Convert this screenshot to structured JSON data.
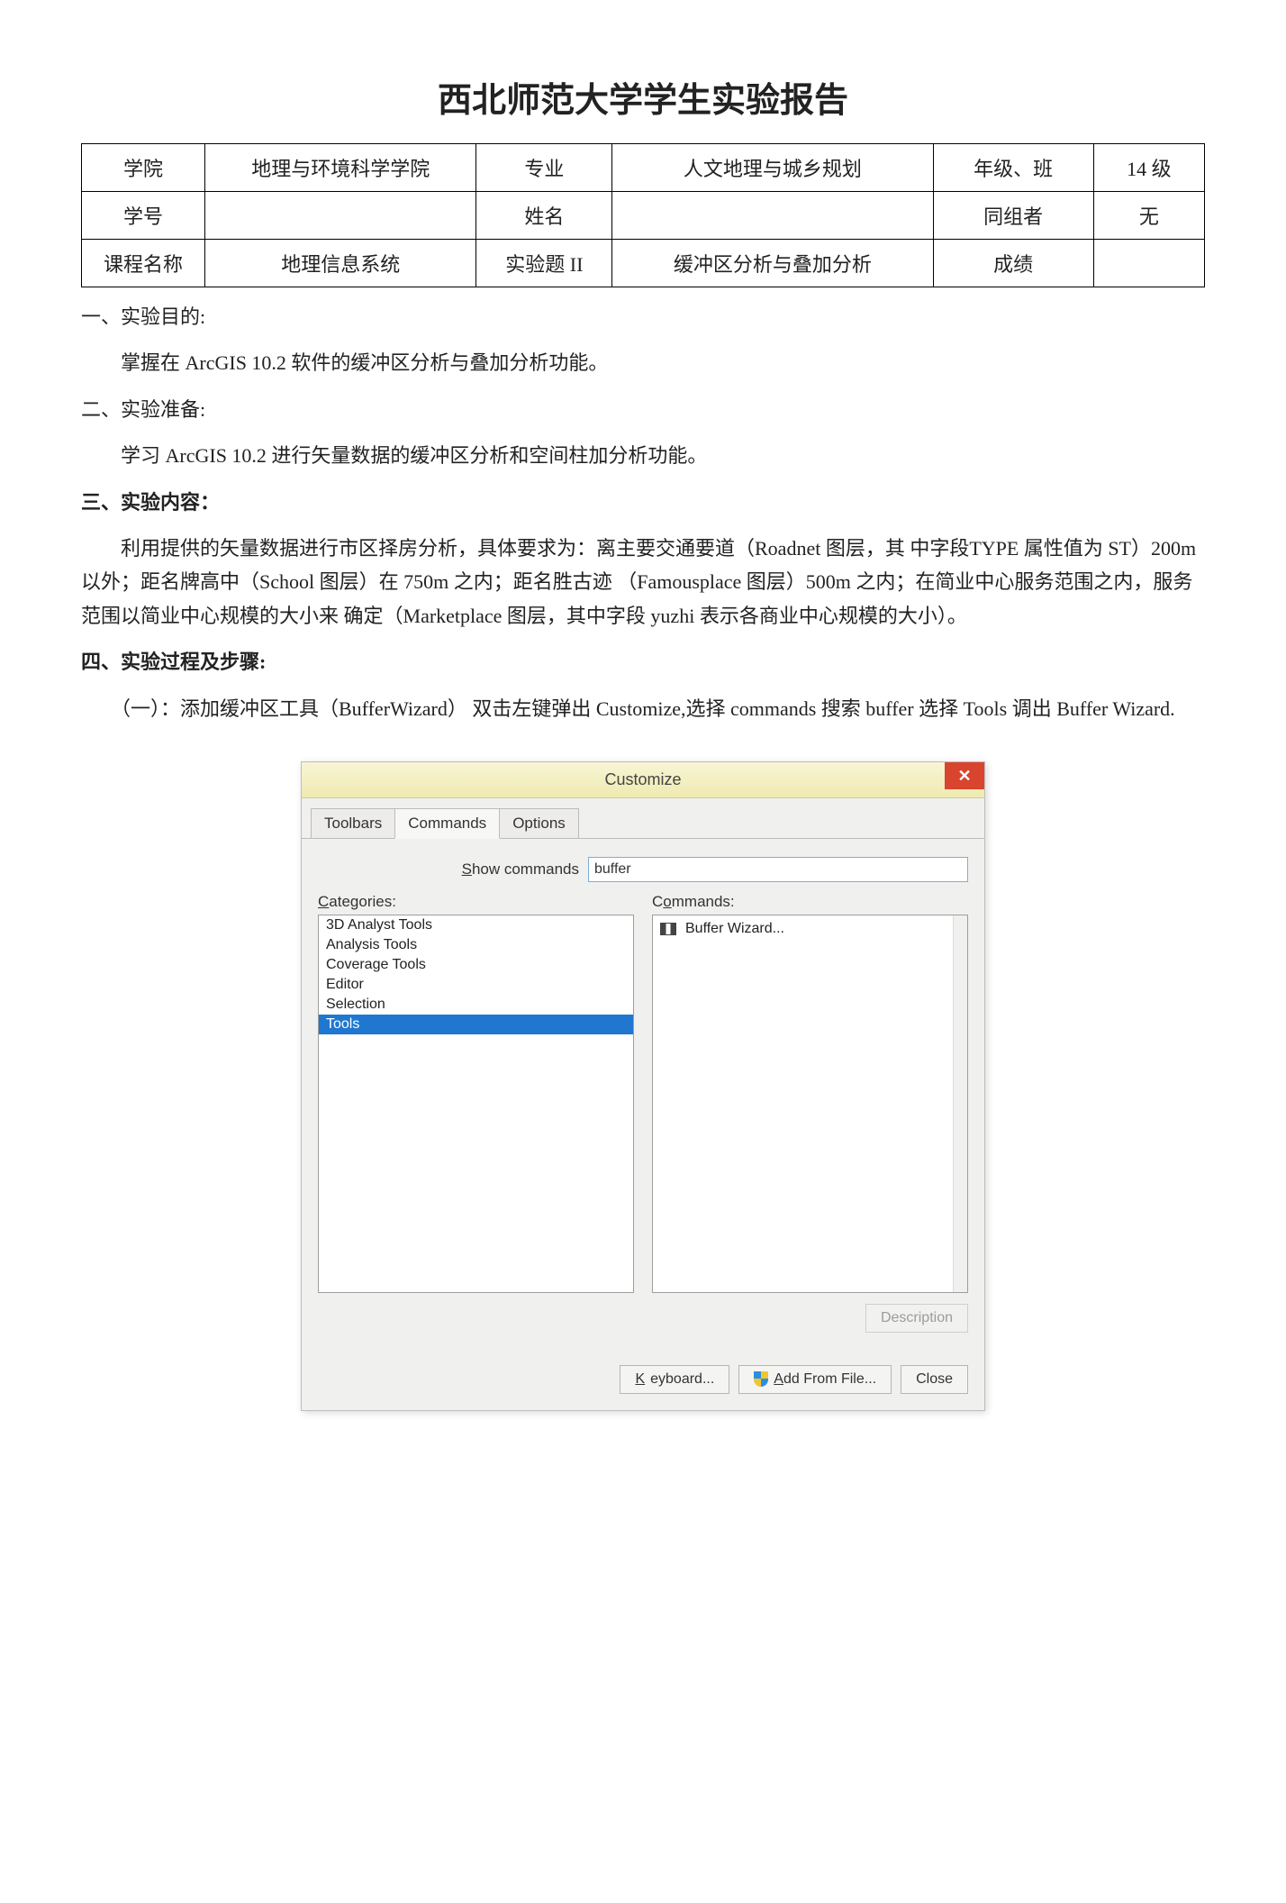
{
  "title": "西北师范大学学生实验报告",
  "info": {
    "r1": {
      "c1": "学院",
      "c2": "地理与环境科学学院",
      "c3": "专业",
      "c4": "人文地理与城乡规划",
      "c5": "年级、班",
      "c6": "14 级"
    },
    "r2": {
      "c1": "学号",
      "c2": "",
      "c3": "姓名",
      "c4": "",
      "c5": "同组者",
      "c6": "无"
    },
    "r3": {
      "c1": "课程名称",
      "c2": "地理信息系统",
      "c3": "实验题 II",
      "c4": "缓冲区分析与叠加分析",
      "c5": "成绩",
      "c6": ""
    }
  },
  "sec1_h": "一、实验目的:",
  "sec1_p": "掌握在 ArcGIS 10.2 软件的缓冲区分析与叠加分析功能。",
  "sec2_h": "二、实验准备:",
  "sec2_p": "学习 ArcGIS 10.2 进行矢量数据的缓冲区分析和空间柱加分析功能。",
  "sec3_h": "三、实验内容：",
  "sec3_p": "利用提供的矢量数据进行市区择房分析，具体要求为：离主要交通要道（Roadnet 图层，其 中字段TYPE 属性值为 ST）200m 以外；距名牌高中（School 图层）在 750m 之内；距名胜古迹 （Famousplace 图层）500m 之内；在简业中心服务范围之内，服务范围以简业中心规模的大小来 确定（Marketplace 图层，其中字段 yuzhi 表示各商业中心规模的大小）。",
  "sec4_h": "四、实验过程及步骤:",
  "sec4_p": "（一）：添加缓冲区工具（BufferWizard） 双击左键弹出 Customize,选择 commands 搜索 buffer 选择 Tools 调出 Buffer Wizard.",
  "dialog": {
    "title": "Customize",
    "close": "✕",
    "tabs": {
      "t1": "Toolbars",
      "t2": "Commands",
      "t3": "Options"
    },
    "search_label_pre": "S",
    "search_label_rest": "how commands",
    "search_value": "buffer",
    "cat_label_pre": "C",
    "cat_label_rest": "ategories:",
    "cmd_label_pre": "C",
    "cmd_label_u": "o",
    "cmd_label_rest": "mmands:",
    "categories": [
      "3D Analyst Tools",
      "Analysis Tools",
      "Coverage Tools",
      "Editor",
      "Selection",
      "Tools"
    ],
    "selected_category_index": 5,
    "commands": [
      "Buffer Wizard..."
    ],
    "description_label": "Description",
    "footer": {
      "keyboard_pre": "K",
      "keyboard_rest": "eyboard...",
      "addfile_pre": "A",
      "addfile_rest": "dd From File...",
      "close": "Close"
    }
  }
}
